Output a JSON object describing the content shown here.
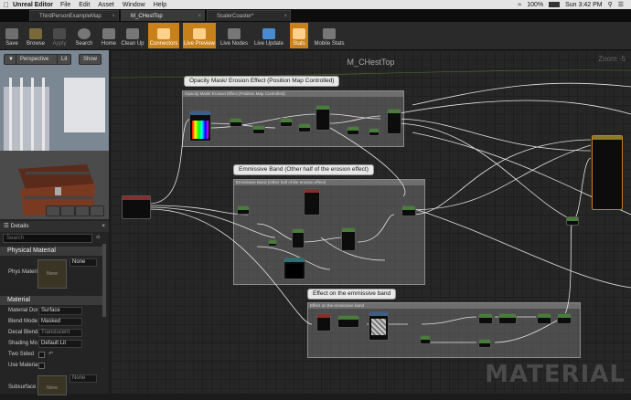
{
  "menubar": {
    "app_name": "Unreal Editor",
    "items": [
      "File",
      "Edit",
      "Asset",
      "Window",
      "Help"
    ],
    "battery": "100%",
    "clock": "Sun 3:42 PM"
  },
  "tabs": [
    "ThirdPersonExampleMap",
    "M_CHestTop",
    "ScalerCoaster*"
  ],
  "toolbar": [
    {
      "label": "Save",
      "state": "normal"
    },
    {
      "label": "Browse",
      "state": "normal"
    },
    {
      "label": "Apply",
      "state": "disabled"
    },
    {
      "label": "Search",
      "state": "normal"
    },
    {
      "label": "Home",
      "state": "normal"
    },
    {
      "label": "Clean Up",
      "state": "normal"
    },
    {
      "label": "Connectors",
      "state": "active"
    },
    {
      "label": "Live Preview",
      "state": "active"
    },
    {
      "label": "Live Nodes",
      "state": "normal"
    },
    {
      "label": "Live Update",
      "state": "normal"
    },
    {
      "label": "Stats",
      "state": "active"
    },
    {
      "label": "Mobile Stats",
      "state": "normal"
    }
  ],
  "viewport": {
    "perspective": "Perspective",
    "lit": "Lit",
    "show": "Show"
  },
  "details": {
    "title": "Details",
    "search_placeholder": "Search",
    "physical_material": {
      "header": "Physical Material",
      "label": "Phys Materi",
      "value": "None",
      "thumb": "None"
    },
    "material": {
      "header": "Material",
      "rows": [
        {
          "label": "Material Don",
          "value": "Surface"
        },
        {
          "label": "Blend Mode",
          "value": "Masked"
        },
        {
          "label": "Decal Blend",
          "value": "Translucent"
        },
        {
          "label": "Shading Mo",
          "value": "Default Lit"
        },
        {
          "label": "Two Sided",
          "value": ""
        },
        {
          "label": "Use Material",
          "value": ""
        },
        {
          "label": "Subsurface",
          "value": "None"
        }
      ],
      "subsurface_thumb": "None"
    }
  },
  "graph": {
    "title": "M_CHestTop",
    "zoom": "Zoom -5",
    "watermark": "MATERIAL",
    "comments": [
      {
        "bubble": "Opacity Mask/ Erosion Effect (Position Map Controlled)",
        "header": "Opacity Mask/ Erosion Effect (Position Map Controlled)"
      },
      {
        "bubble": "Emmissive Band (Other half of the erosion effect)",
        "header": "Emmissive Band (Other half of the erosion effect)"
      },
      {
        "bubble": "Effect on the emmissive band",
        "header": "Effect on the emmissive band"
      }
    ]
  },
  "colors": {
    "accent": "#c8801a",
    "graph_bg": "#262626",
    "wire": "#e6e6e6",
    "exec_wire": "#7fbf3f"
  }
}
